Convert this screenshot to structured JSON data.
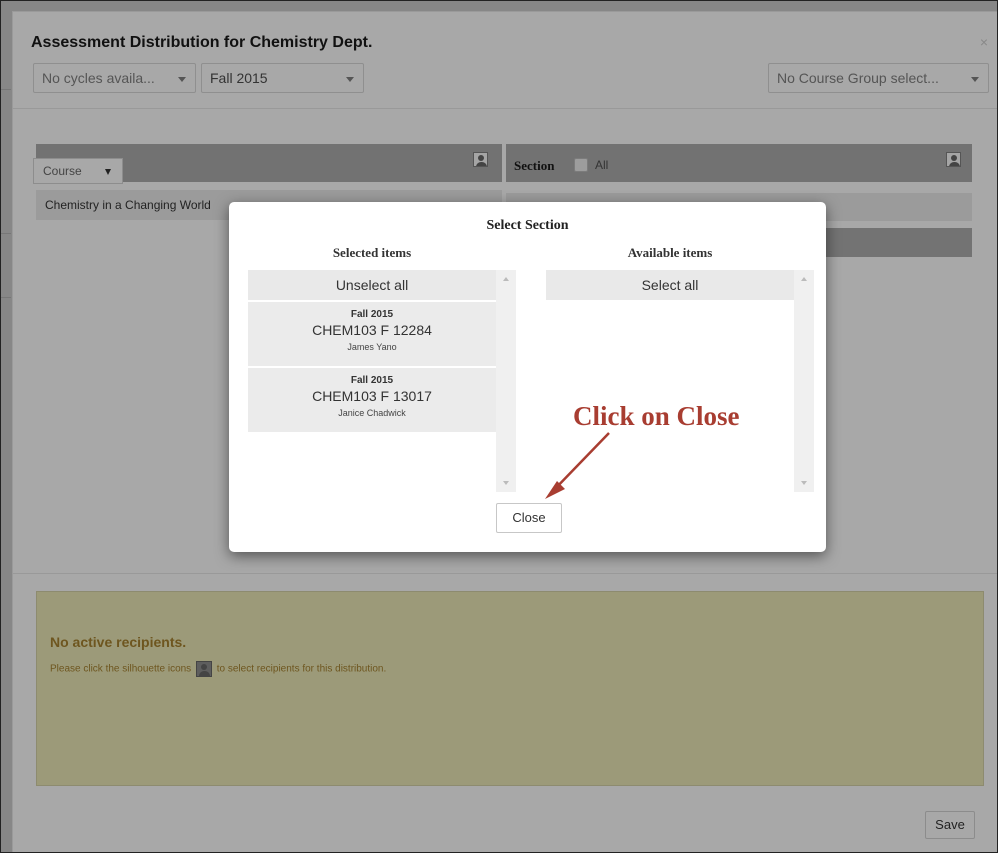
{
  "main_dialog": {
    "title": "Assessment Distribution for Chemistry Dept.",
    "close_glyph": "×",
    "cycles_select": "No cycles availa...",
    "term_select": "Fall 2015",
    "course_group_select": "No Course Group select..."
  },
  "course_panel": {
    "course_dropdown": "Course",
    "rows": [
      "Chemistry in a Changing World"
    ]
  },
  "section_panel": {
    "label": "Section",
    "all_label": "All"
  },
  "modal": {
    "title": "Select Section",
    "selected": {
      "heading": "Selected items",
      "action": "Unselect all",
      "items": [
        {
          "term": "Fall 2015",
          "code": "CHEM103 F 12284",
          "instructor": "James Yano"
        },
        {
          "term": "Fall 2015",
          "code": "CHEM103 F 13017",
          "instructor": "Janice Chadwick"
        }
      ]
    },
    "available": {
      "heading": "Available items",
      "action": "Select all"
    },
    "close_label": "Close"
  },
  "annotation": {
    "text": "Click on Close",
    "color": "#a83d31"
  },
  "notice": {
    "title": "No active recipients.",
    "text_before": "Please click the silhouette icons",
    "text_after": "to select recipients for this distribution."
  },
  "footer": {
    "save_label": "Save"
  }
}
